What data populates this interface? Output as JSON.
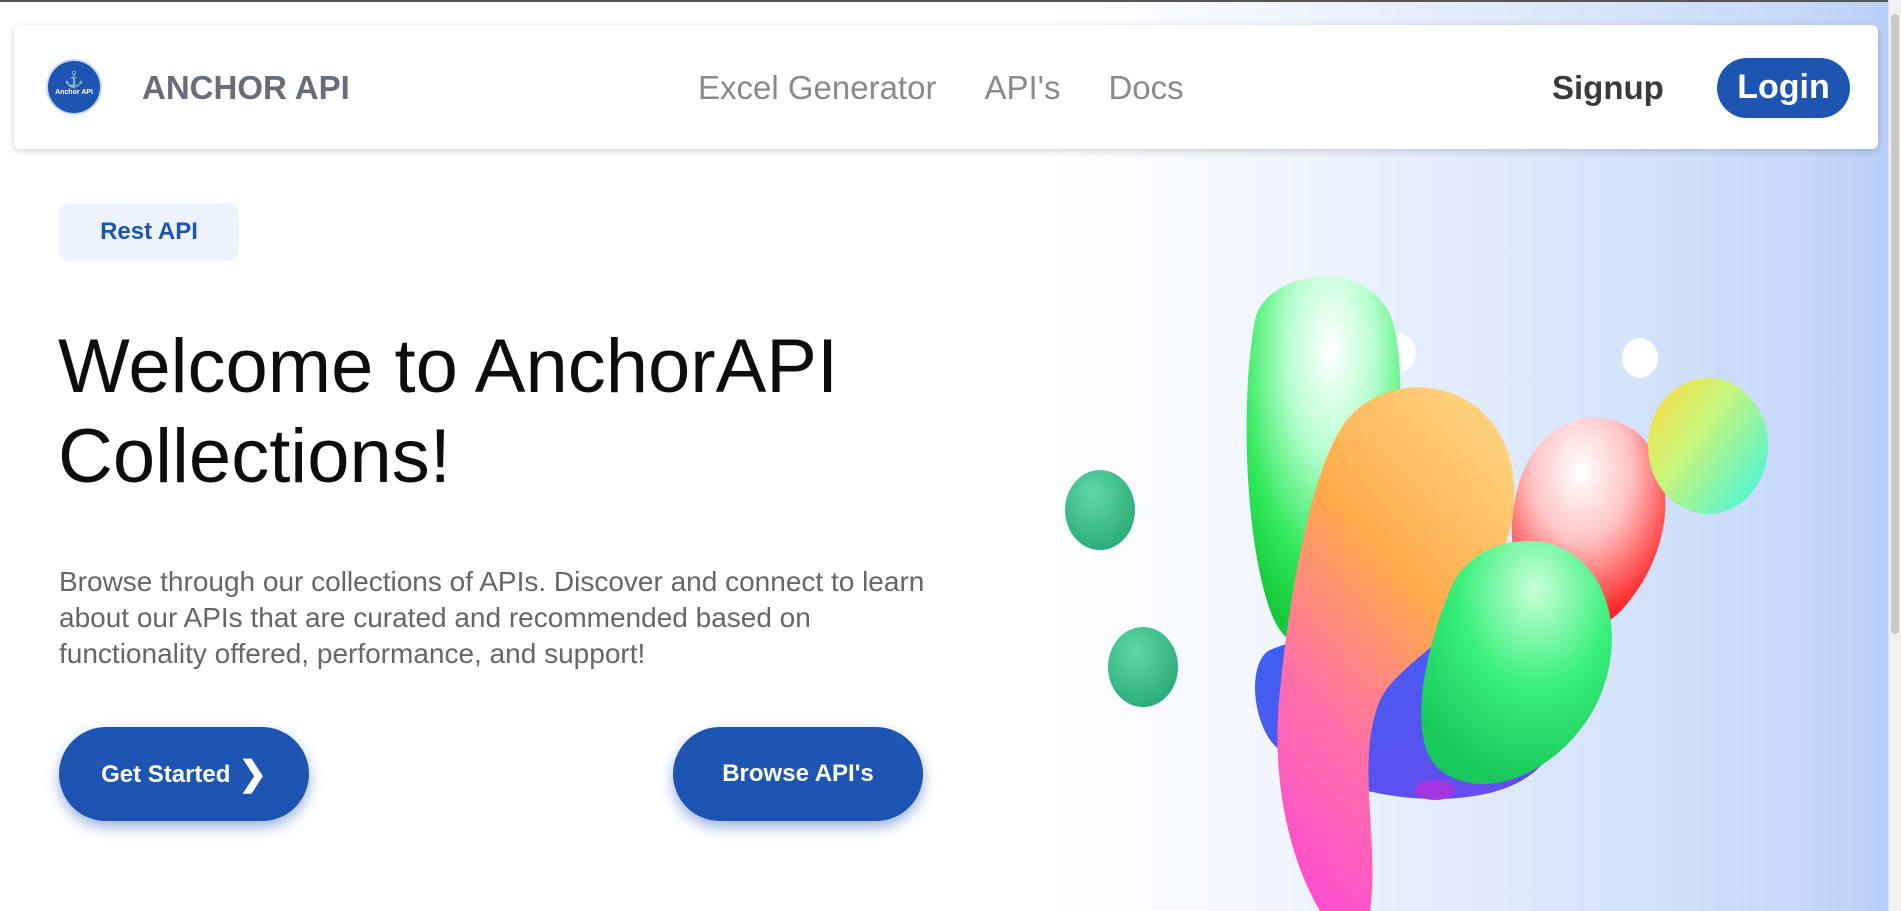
{
  "header": {
    "logo_text": "Anchor API",
    "brand": "ANCHOR API",
    "nav": [
      "Excel Generator",
      "API's",
      "Docs"
    ],
    "signup": "Signup",
    "login": "Login"
  },
  "hero": {
    "badge": "Rest API",
    "title": "Welcome to AnchorAPI Collections!",
    "description": "Browse through our collections of APIs. Discover and connect to learn about our APIs that are curated and recommended based on functionality offered, performance, and support!",
    "get_started": "Get Started",
    "browse": "Browse API's"
  },
  "colors": {
    "primary": "#1e55b3",
    "badge_bg": "#edf3fc",
    "nav_text": "#8a8a8a",
    "brand_text": "#6a6d78"
  },
  "icons": {
    "logo": "anchor-icon",
    "get_started": "chevron-right-icon"
  }
}
